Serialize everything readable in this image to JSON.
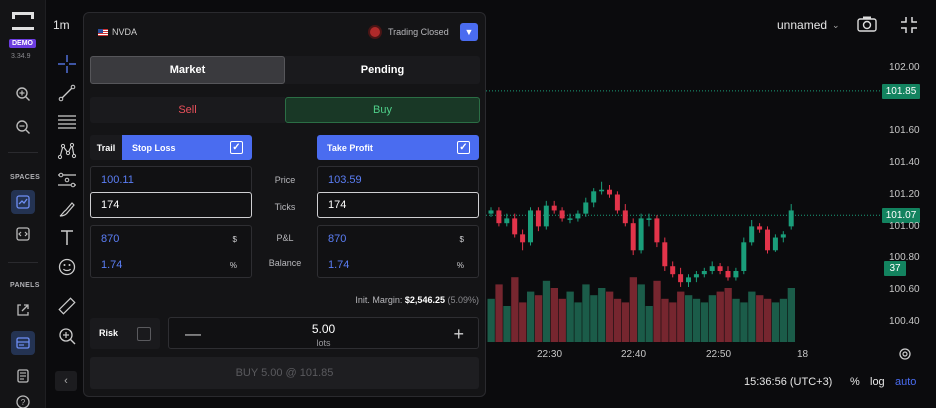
{
  "rail": {
    "badge": "DEMO",
    "version": "3.34.9",
    "spaces_label": "SPACES",
    "panels_label": "PANELS"
  },
  "chart_toolbar": {
    "timeframe": "1m",
    "layout_name": "unnamed"
  },
  "order_panel": {
    "symbol": "NVDA",
    "status": "Trading Closed",
    "tabs": [
      "Market",
      "Pending"
    ],
    "sell_label": "Sell",
    "buy_label": "Buy",
    "trail_label": "Trail",
    "stop_loss_label": "Stop Loss",
    "take_profit_label": "Take Profit",
    "labels": {
      "price": "Price",
      "ticks": "Ticks",
      "pnl": "P&L",
      "balance": "Balance"
    },
    "stop_loss": {
      "price": "100.11",
      "ticks": "174",
      "pnl": "870",
      "balance": "1.74"
    },
    "take_profit": {
      "price": "103.59",
      "ticks": "174",
      "pnl": "870",
      "balance": "1.74"
    },
    "units": {
      "currency": "$",
      "percent": "%"
    },
    "margin_label": "Init. Margin:",
    "margin_value": "$2,546.25",
    "margin_pct": "(5.09%)",
    "risk_label": "Risk",
    "quantity": "5.00",
    "quantity_unit": "lots",
    "submit_label": "BUY 5.00 @ 101.85"
  },
  "price_axis": {
    "ticks": [
      "102.00",
      "101.60",
      "101.40",
      "101.20",
      "101.00",
      "100.80",
      "100.60",
      "100.40"
    ],
    "last_price": "101.85",
    "level_price": "101.07",
    "volume_badge": "37"
  },
  "time_axis": {
    "ticks": [
      "22:30",
      "22:40",
      "22:50",
      "18"
    ]
  },
  "status_bar": {
    "clock": "15:36:56 (UTC+3)",
    "percent": "%",
    "log": "log",
    "auto": "auto"
  },
  "colors": {
    "bull": "#1a9e7a",
    "bear": "#e2344a",
    "accent": "#4a6cf0"
  },
  "chart_data": {
    "type": "candlestick",
    "x": [
      "c1",
      "c2",
      "c3",
      "c4",
      "c5",
      "c6",
      "c7",
      "c8",
      "c9",
      "c10",
      "c11",
      "c12",
      "c13",
      "c14",
      "c15",
      "c16",
      "c17",
      "c18",
      "c19",
      "c20",
      "c21",
      "c22",
      "c23",
      "c24",
      "c25",
      "c26",
      "c27",
      "c28",
      "c29",
      "c30",
      "c31",
      "c32",
      "c33",
      "c34",
      "c35",
      "c36",
      "c37",
      "c38",
      "c39"
    ],
    "open": [
      101.08,
      101.1,
      101.02,
      101.05,
      100.95,
      100.9,
      101.1,
      101.0,
      101.13,
      101.1,
      101.05,
      101.05,
      101.08,
      101.15,
      101.22,
      101.23,
      101.2,
      101.1,
      101.02,
      100.85,
      101.05,
      101.05,
      100.9,
      100.75,
      100.7,
      100.65,
      100.68,
      100.7,
      100.72,
      100.75,
      100.72,
      100.68,
      100.72,
      100.9,
      101.0,
      100.98,
      100.85,
      100.93,
      101.0
    ],
    "close": [
      101.1,
      101.02,
      101.05,
      100.95,
      100.9,
      101.1,
      101.0,
      101.13,
      101.1,
      101.05,
      101.05,
      101.08,
      101.15,
      101.22,
      101.23,
      101.2,
      101.1,
      101.02,
      100.85,
      101.05,
      101.05,
      100.9,
      100.75,
      100.7,
      100.65,
      100.68,
      100.7,
      100.72,
      100.75,
      100.72,
      100.68,
      100.72,
      100.9,
      101.0,
      100.98,
      100.85,
      100.93,
      100.95,
      101.1
    ],
    "high": [
      101.12,
      101.12,
      101.08,
      101.08,
      100.98,
      101.12,
      101.12,
      101.16,
      101.16,
      101.12,
      101.08,
      101.1,
      101.18,
      101.24,
      101.28,
      101.26,
      101.22,
      101.14,
      101.05,
      101.08,
      101.08,
      101.07,
      100.93,
      100.78,
      100.74,
      100.7,
      100.72,
      100.74,
      100.78,
      100.77,
      100.75,
      100.74,
      100.93,
      101.04,
      101.02,
      101.0,
      100.95,
      100.97,
      101.14
    ],
    "low": [
      101.06,
      101.0,
      101.0,
      100.93,
      100.85,
      100.88,
      100.97,
      100.98,
      101.08,
      101.03,
      101.02,
      101.03,
      101.06,
      101.12,
      101.2,
      101.18,
      101.08,
      101.0,
      100.82,
      100.83,
      101.0,
      100.87,
      100.72,
      100.68,
      100.62,
      100.62,
      100.65,
      100.68,
      100.7,
      100.7,
      100.66,
      100.66,
      100.7,
      100.88,
      100.96,
      100.83,
      100.84,
      100.9,
      100.98
    ],
    "volume": [
      60,
      80,
      50,
      90,
      55,
      70,
      65,
      85,
      75,
      60,
      70,
      55,
      80,
      65,
      75,
      70,
      60,
      55,
      90,
      80,
      50,
      85,
      60,
      55,
      70,
      65,
      60,
      55,
      65,
      70,
      75,
      60,
      55,
      70,
      65,
      60,
      55,
      60,
      75
    ],
    "ylim": [
      100.3,
      102.1
    ],
    "last_price": 101.85,
    "level_price": 101.07
  }
}
